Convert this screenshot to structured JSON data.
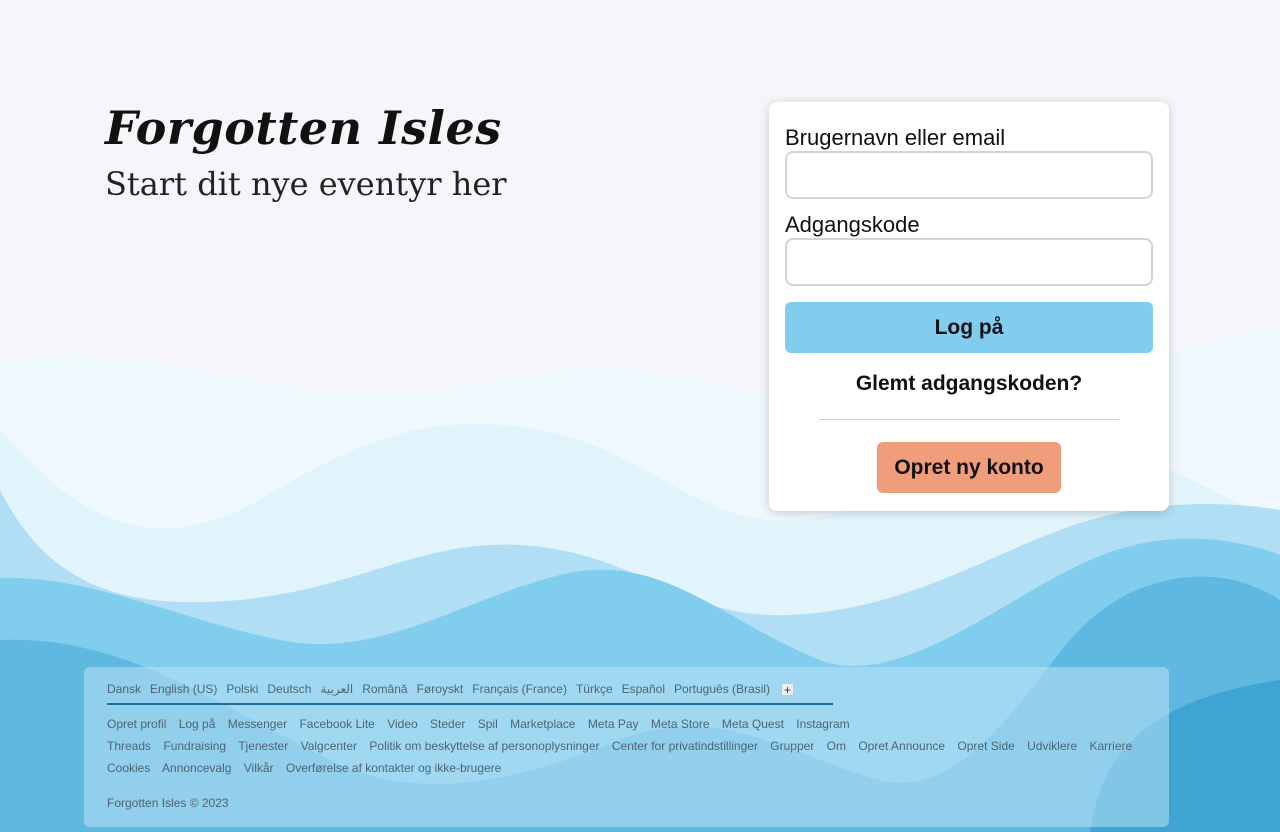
{
  "brand": {
    "title": "Forgotten Isles",
    "subtitle": "Start dit nye eventyr her"
  },
  "login": {
    "username_label": "Brugernavn eller email",
    "username_value": "",
    "password_label": "Adgangskode",
    "password_value": "",
    "login_button": "Log på",
    "forgot_link": "Glemt adgangskoden?",
    "create_account_button": "Opret ny konto"
  },
  "colors": {
    "login_button": "#80cdef",
    "create_button": "#f09d7b",
    "background": "#f6f6fa",
    "wave_light": "#e4f4fb",
    "wave_mid": "#b0def4",
    "wave_blue": "#7fcbed",
    "wave_deep": "#3fa4d2"
  },
  "footer": {
    "languages": [
      "Dansk",
      "English (US)",
      "Polski",
      "Deutsch",
      "العربية",
      "Română",
      "Føroyskt",
      "Français (France)",
      "Türkçe",
      "Español",
      "Português (Brasil)"
    ],
    "add_language_icon": "plus-icon",
    "link_rows": [
      [
        "Opret profil",
        "Log på",
        "Messenger",
        "Facebook Lite",
        "Video",
        "Steder",
        "Spil",
        "Marketplace",
        "Meta Pay",
        "Meta Store",
        "Meta Quest",
        "Instagram"
      ],
      [
        "Threads",
        "Fundraising",
        "Tjenester",
        "Valgcenter",
        "Politik om beskyttelse af personoplysninger",
        "Center for privatindstillinger",
        "Grupper",
        "Om",
        "Opret Announce",
        "Opret Side",
        "Udviklere",
        "Karriere"
      ],
      [
        "Cookies",
        "Annoncevalg",
        "Vilkår",
        "Overførelse af kontakter og ikke-brugere"
      ]
    ],
    "copyright": "Forgotten Isles © 2023"
  }
}
